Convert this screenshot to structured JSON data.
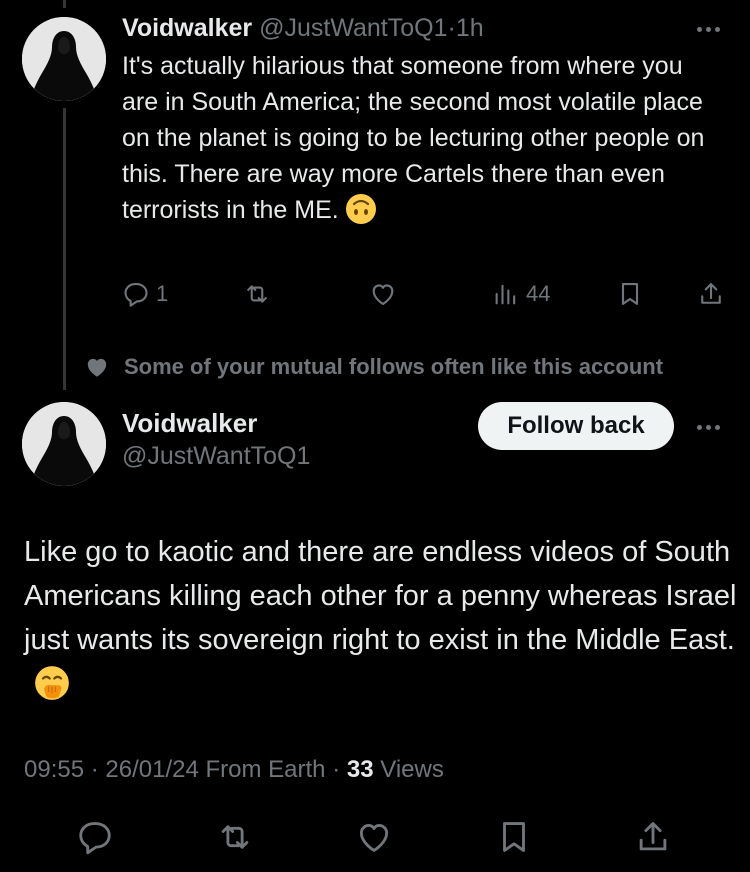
{
  "reply_tweet": {
    "display_name": "Voidwalker",
    "handle": "@JustWantToQ1",
    "separator": "·",
    "time": "1h",
    "text": "It's actually hilarious that someone from where you are in South America; the second most volatile place on the planet is going to be lecturing other people on this. There are way more Cartels there than even terrorists in the ME.",
    "emoji": "upside-down-face",
    "actions": {
      "reply_count": "1",
      "views_count": "44"
    }
  },
  "social_context": {
    "text": "Some of your mutual follows often like this account",
    "icon": "heart-icon"
  },
  "main_tweet": {
    "display_name": "Voidwalker",
    "handle": "@JustWantToQ1",
    "follow_label": "Follow back",
    "text": "Like go to kaotic and there are endless videos of South Americans killing each other for a penny whereas Israel just wants its sovereign right to exist in the Middle East.",
    "emoji": "face-with-hand-over-mouth",
    "meta": {
      "time": "09:55",
      "dot1": "·",
      "date": "26/01/24",
      "source": "From Earth",
      "dot2": "·",
      "views_count": "33",
      "views_label": "Views"
    }
  },
  "colors": {
    "background": "#000000",
    "text": "#e7e9ea",
    "muted": "#71767b",
    "follow_button": "#eff3f4"
  }
}
